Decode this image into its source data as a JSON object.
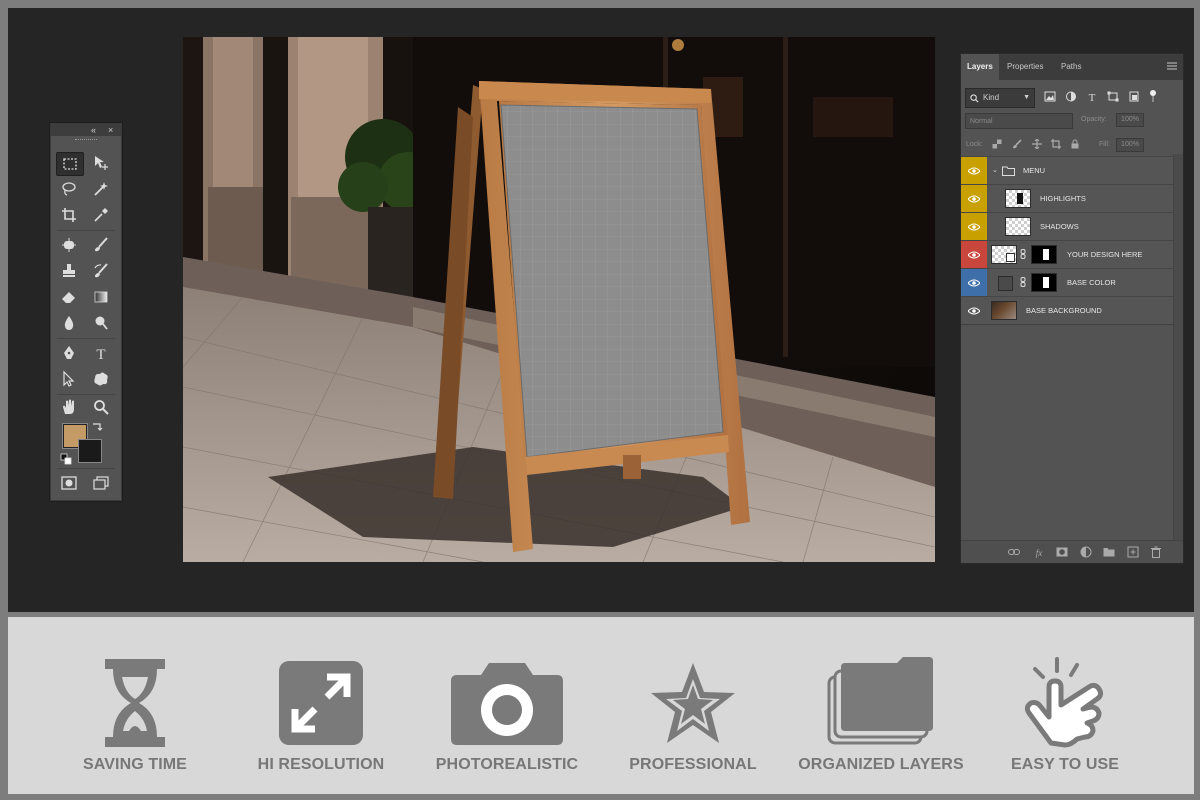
{
  "layers_panel": {
    "tabs": [
      "Layers",
      "Properties",
      "Paths"
    ],
    "filter_kind": "Kind",
    "blend_mode": "Normal",
    "opacity_label": "Opacity:",
    "opacity_value": "100%",
    "lock_label": "Lock:",
    "fill_label": "Fill:",
    "fill_value": "100%",
    "layers": [
      {
        "name": "MENU",
        "color": "#c8a000"
      },
      {
        "name": "HIGHLIGHTS",
        "color": "#c8a000"
      },
      {
        "name": "SHADOWS",
        "color": "#c8a000"
      },
      {
        "name": "YOUR DESIGN HERE",
        "color": "#c8463c"
      },
      {
        "name": "BASE COLOR",
        "color": "#3f6fa8"
      },
      {
        "name": "BASE BACKGROUND",
        "color": "#555555"
      }
    ]
  },
  "tools": {
    "foreground_color": "#c49a66",
    "background_color": "#1a1a1a"
  },
  "features": [
    {
      "label": "SAVING TIME",
      "icon": "hourglass-icon"
    },
    {
      "label": "HI RESOLUTION",
      "icon": "expand-arrows-icon"
    },
    {
      "label": "PHOTOREALISTIC",
      "icon": "camera-icon"
    },
    {
      "label": "PROFESSIONAL",
      "icon": "star-icon"
    },
    {
      "label": "ORGANIZED LAYERS",
      "icon": "layered-folders-icon"
    },
    {
      "label": "EASY TO USE",
      "icon": "tap-hand-icon"
    }
  ]
}
